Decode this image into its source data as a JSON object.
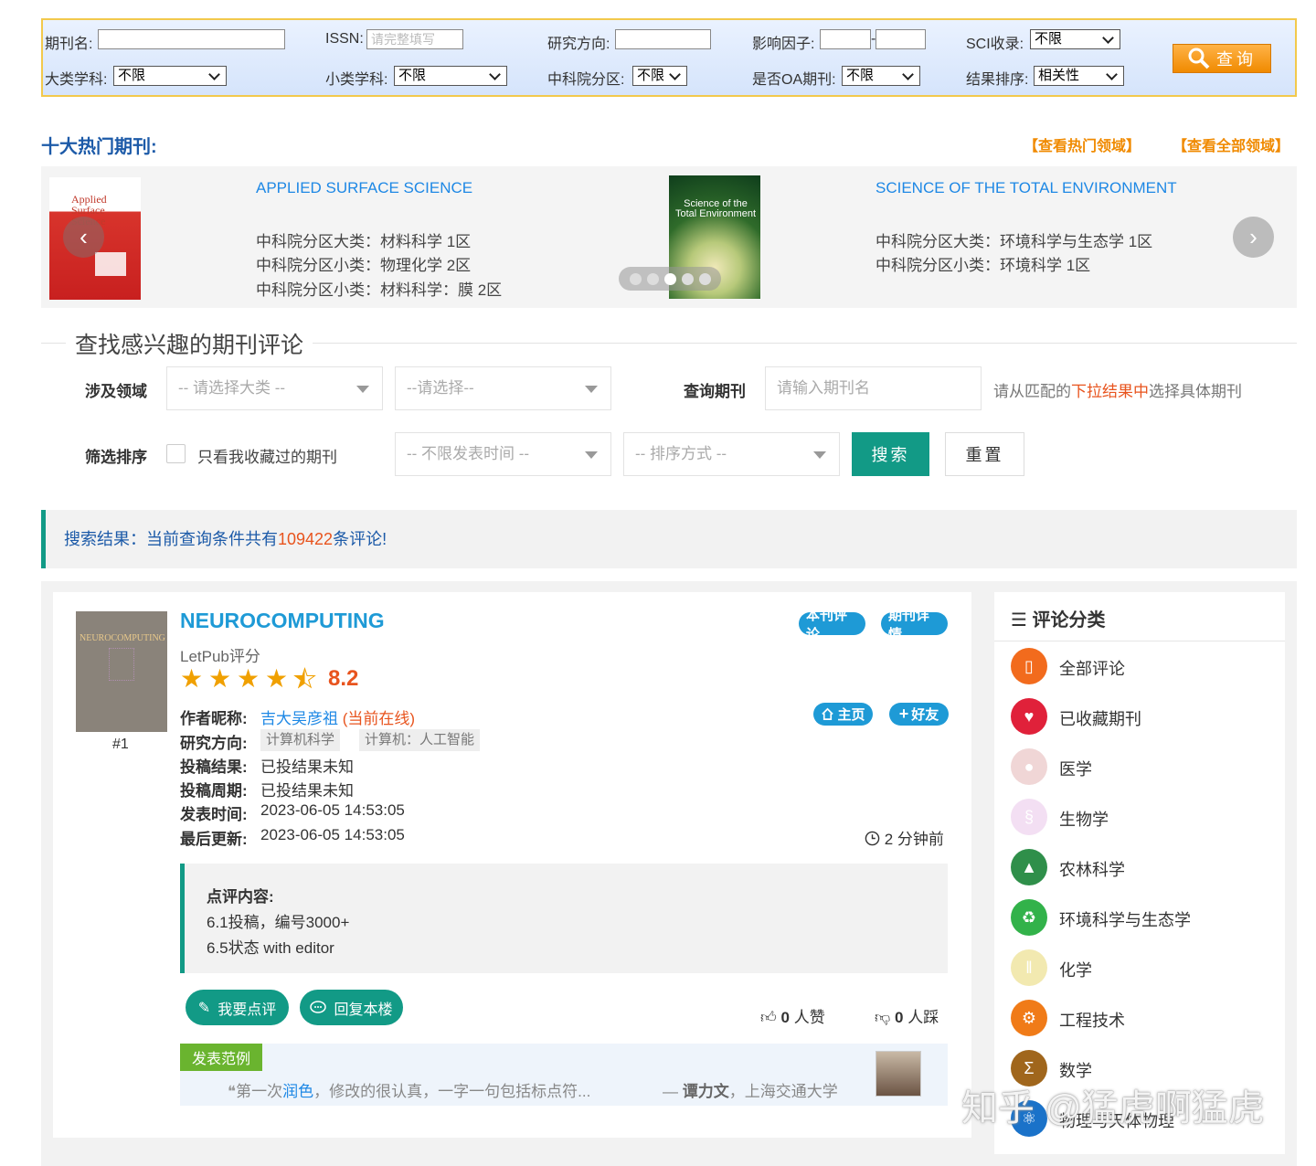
{
  "top_search": {
    "journal_name_label": "期刊名:",
    "issn_label": "ISSN:",
    "issn_placeholder": "请完整填写",
    "direction_label": "研究方向:",
    "impact_label": "影响因子:",
    "impact_sep": "-",
    "sci_label": "SCI收录:",
    "sci_value": "不限",
    "major_label": "大类学科:",
    "major_value": "不限",
    "minor_label": "小类学科:",
    "minor_value": "不限",
    "cas_label": "中科院分区:",
    "cas_value": "不限",
    "oa_label": "是否OA期刊:",
    "oa_value": "不限",
    "sort_label": "结果排序:",
    "sort_value": "相关性",
    "query_button": "查询"
  },
  "hot": {
    "title": "十大热门期刊:",
    "link_hot_fields": "【查看热门领域】",
    "link_all_fields": "【查看全部领域】",
    "journals": [
      {
        "title": "APPLIED SURFACE SCIENCE",
        "cover_text_1": "Applied",
        "cover_text_2": "Surface Science",
        "lines": [
          "中科院分区大类：材料科学 1区",
          "中科院分区小类：物理化学 2区",
          "中科院分区小类：材料科学：膜 2区"
        ]
      },
      {
        "title": "SCIENCE OF THE TOTAL ENVIRONMENT",
        "cover_text_1": "Science of the",
        "cover_text_2": "Total Environment",
        "lines": [
          "中科院分区大类：环境科学与生态学 1区",
          "中科院分区小类：环境科学 1区"
        ]
      }
    ],
    "prev_icon": "chevron-left-icon",
    "next_icon": "chevron-right-icon",
    "dot_count": 5,
    "active_dot": 3
  },
  "find": {
    "title": "查找感兴趣的期刊评论",
    "field_label": "涉及领域",
    "field_major_placeholder": "-- 请选择大类 --",
    "field_minor_placeholder": "--请选择--",
    "query_journal_label": "查询期刊",
    "query_journal_placeholder": "请输入期刊名",
    "hint_prefix": "请从匹配的",
    "hint_highlight": "下拉结果中",
    "hint_suffix": "选择具体期刊",
    "filter_label": "筛选排序",
    "only_favorites": "只看我收藏过的期刊",
    "time_placeholder": "-- 不限发表时间 --",
    "order_placeholder": "-- 排序方式 --",
    "search_button": "搜索",
    "reset_button": "重置"
  },
  "result": {
    "prefix": "搜索结果：当前查询条件共有",
    "count": "109422",
    "suffix": "条评论!"
  },
  "review": {
    "rank": "#1",
    "cover_text": "NEUROCOMPUTING",
    "journal": "NEUROCOMPUTING",
    "btn_this_review": "本刊评论",
    "btn_journal_detail": "期刊详情",
    "letpub_label": "LetPub评分",
    "rating": 4.5,
    "score": "8.2",
    "author_key": "作者昵称:",
    "author_name": "吉大吴彦祖",
    "author_status": "(当前在线)",
    "btn_home": "主页",
    "btn_friend": "好友",
    "direction_key": "研究方向:",
    "tags": [
      "计算机科学",
      "计算机：人工智能"
    ],
    "result_key": "投稿结果:",
    "result_val": "已投结果未知",
    "period_key": "投稿周期:",
    "period_val": "已投结果未知",
    "publish_key": "发表时间:",
    "publish_val": "2023-06-05 14:53:05",
    "update_key": "最后更新:",
    "update_val": "2023-06-05 14:53:05",
    "time_ago": "2 分钟前",
    "content_title": "点评内容:",
    "content_lines": [
      "6.1投稿，编号3000+",
      "6.5状态 with editor"
    ],
    "btn_write": "我要点评",
    "btn_reply": "回复本楼",
    "likes": "0",
    "likes_unit": "人赞",
    "dislikes": "0",
    "dislikes_unit": "人踩",
    "example_tag": "发表范例",
    "example_text_pre": "第一次",
    "example_text_link": "润色",
    "example_text_post": "，修改的很认真，一字一句包括标点符...",
    "example_author_dash": "—",
    "example_author_name": "谭力文",
    "example_author_org": "，上海交通大学"
  },
  "sidebar": {
    "title": "评论分类",
    "categories": [
      {
        "label": "全部评论",
        "icon": "phone-icon",
        "color": "#f26b1d"
      },
      {
        "label": "已收藏期刊",
        "icon": "heart-icon",
        "color": "#e0213a"
      },
      {
        "label": "医学",
        "icon": "pill-icon",
        "color": "#f0d6d6"
      },
      {
        "label": "生物学",
        "icon": "dna-icon",
        "color": "#f3dff3"
      },
      {
        "label": "农林科学",
        "icon": "tree-icon",
        "color": "#2f8f4a"
      },
      {
        "label": "环境科学与生态学",
        "icon": "recycle-icon",
        "color": "#32b24a"
      },
      {
        "label": "化学",
        "icon": "test-tubes-icon",
        "color": "#f2e9b0"
      },
      {
        "label": "工程技术",
        "icon": "engineer-icon",
        "color": "#f07b18"
      },
      {
        "label": "数学",
        "icon": "sigma-icon",
        "color": "#a0661c"
      },
      {
        "label": "物理与天体物理",
        "icon": "atom-icon",
        "color": "#1a72c9"
      }
    ]
  },
  "watermark": "知乎 @猛虎啊猛虎"
}
